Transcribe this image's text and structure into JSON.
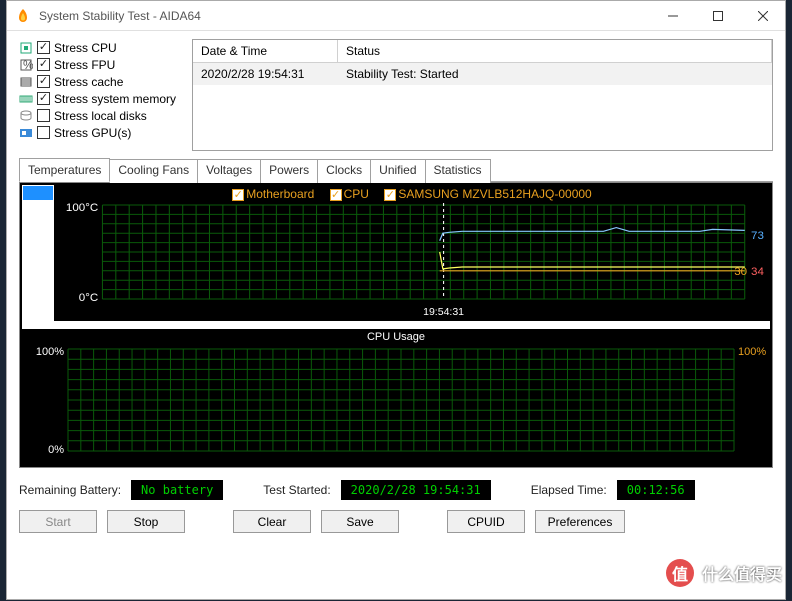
{
  "window": {
    "title": "System Stability Test - AIDA64"
  },
  "stress": {
    "items": [
      {
        "label": "Stress CPU",
        "checked": true
      },
      {
        "label": "Stress FPU",
        "checked": true
      },
      {
        "label": "Stress cache",
        "checked": true
      },
      {
        "label": "Stress system memory",
        "checked": true
      },
      {
        "label": "Stress local disks",
        "checked": false
      },
      {
        "label": "Stress GPU(s)",
        "checked": false
      }
    ]
  },
  "log": {
    "headers": {
      "datetime": "Date & Time",
      "status": "Status"
    },
    "row": {
      "datetime": "2020/2/28 19:54:31",
      "status": "Stability Test: Started"
    }
  },
  "tabs": [
    "Temperatures",
    "Cooling Fans",
    "Voltages",
    "Powers",
    "Clocks",
    "Unified",
    "Statistics"
  ],
  "tabs_active_index": 0,
  "temp_legend": {
    "motherboard": "Motherboard",
    "cpu": "CPU",
    "ssd": "SAMSUNG MZVLB512HAJQ-00000"
  },
  "chart_data": [
    {
      "type": "line",
      "title": "",
      "xlabel_time": "19:54:31",
      "ylabel_top": "100°C",
      "ylabel_bottom": "0°C",
      "ylim": [
        0,
        100
      ],
      "x": [
        0,
        0.52,
        0.525,
        0.53,
        0.54,
        0.56,
        0.62,
        0.78,
        0.8,
        0.82,
        0.93,
        0.95,
        1.0
      ],
      "series": [
        {
          "name": "CPU",
          "color": "#88c8ff",
          "current": 73,
          "values": [
            null,
            null,
            62,
            70,
            71,
            72,
            72,
            72,
            76,
            72,
            72,
            74,
            73
          ]
        },
        {
          "name": "SAMSUNG MZVLB512HAJQ-00000",
          "color": "#ffff60",
          "current": 34,
          "values": [
            null,
            null,
            50,
            32,
            33,
            34,
            34,
            34,
            34,
            34,
            34,
            34,
            34
          ]
        },
        {
          "name": "Motherboard",
          "color": "#e8a020",
          "current": 30,
          "values": [
            null,
            null,
            30,
            30,
            30,
            30,
            30,
            30,
            30,
            30,
            30,
            30,
            30
          ]
        }
      ]
    },
    {
      "type": "line",
      "title": "CPU Usage",
      "ylabel_top": "100%",
      "ylabel_bottom": "0%",
      "ylim": [
        0,
        100
      ],
      "current_label": "100%",
      "x": [
        0,
        1.0
      ],
      "series": [
        {
          "name": "CPU Usage",
          "color": "#00d000",
          "values": [
            null,
            null
          ]
        }
      ]
    }
  ],
  "status": {
    "battery_label": "Remaining Battery:",
    "battery_value": "No battery",
    "started_label": "Test Started:",
    "started_value": "2020/2/28 19:54:31",
    "elapsed_label": "Elapsed Time:",
    "elapsed_value": "00:12:56"
  },
  "buttons": {
    "start": "Start",
    "stop": "Stop",
    "clear": "Clear",
    "save": "Save",
    "cpuid": "CPUID",
    "prefs": "Preferences"
  },
  "watermark": {
    "text": "什么值得买",
    "logo": "值"
  }
}
